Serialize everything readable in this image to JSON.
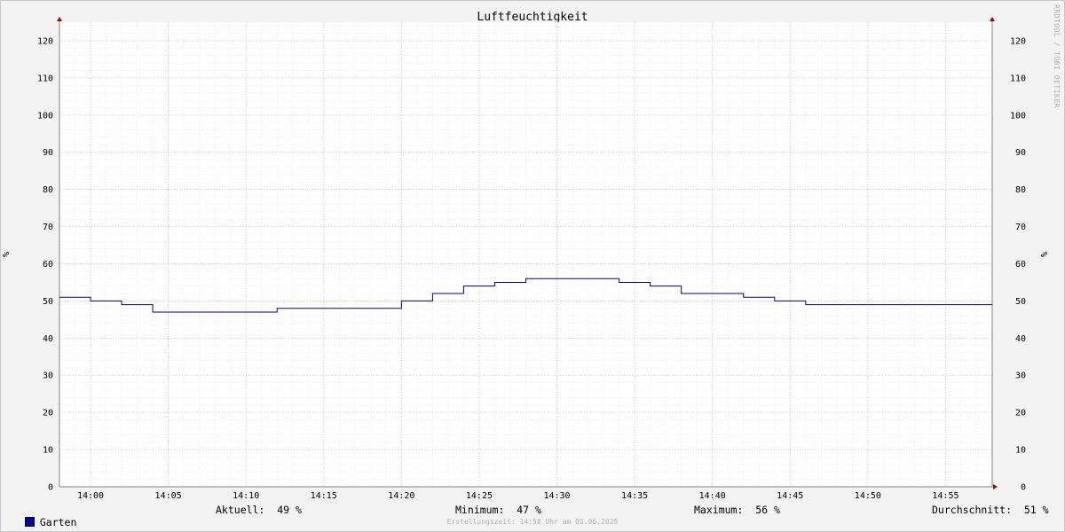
{
  "chart_data": {
    "type": "line",
    "title": "Luftfeuchtigkeit",
    "ylabel": "%",
    "ylim": [
      0,
      125
    ],
    "yticks": [
      0,
      10,
      20,
      30,
      40,
      50,
      60,
      70,
      80,
      90,
      100,
      110,
      120
    ],
    "xlim": [
      "13:58",
      "14:58"
    ],
    "xticks": [
      "14:00",
      "14:05",
      "14:10",
      "14:15",
      "14:20",
      "14:25",
      "14:30",
      "14:35",
      "14:40",
      "14:45",
      "14:50",
      "14:55"
    ],
    "grid": true,
    "line_color": "#000080",
    "series": [
      {
        "name": "Garten",
        "step": true,
        "x": [
          "13:58",
          "14:00",
          "14:02",
          "14:04",
          "14:12",
          "14:20",
          "14:22",
          "14:24",
          "14:26",
          "14:28",
          "14:34",
          "14:36",
          "14:38",
          "14:42",
          "14:44",
          "14:46",
          "14:58"
        ],
        "y": [
          51,
          50,
          49,
          47,
          48,
          50,
          52,
          54,
          55,
          56,
          55,
          54,
          52,
          51,
          50,
          49,
          49
        ]
      }
    ],
    "watermark": "RRDTOOL / TOBI OETIKER"
  },
  "legend": {
    "swatch_color": "#0000a0",
    "name": "Garten",
    "current": "Aktuell:  49 %",
    "minimum": "Minimum:  47 %",
    "maximum": "Maximum:  56 %",
    "average": "Durchschnitt:  51 %"
  },
  "footer": "Erstellungszeit: 14:58 Uhr am 05.06.2025"
}
